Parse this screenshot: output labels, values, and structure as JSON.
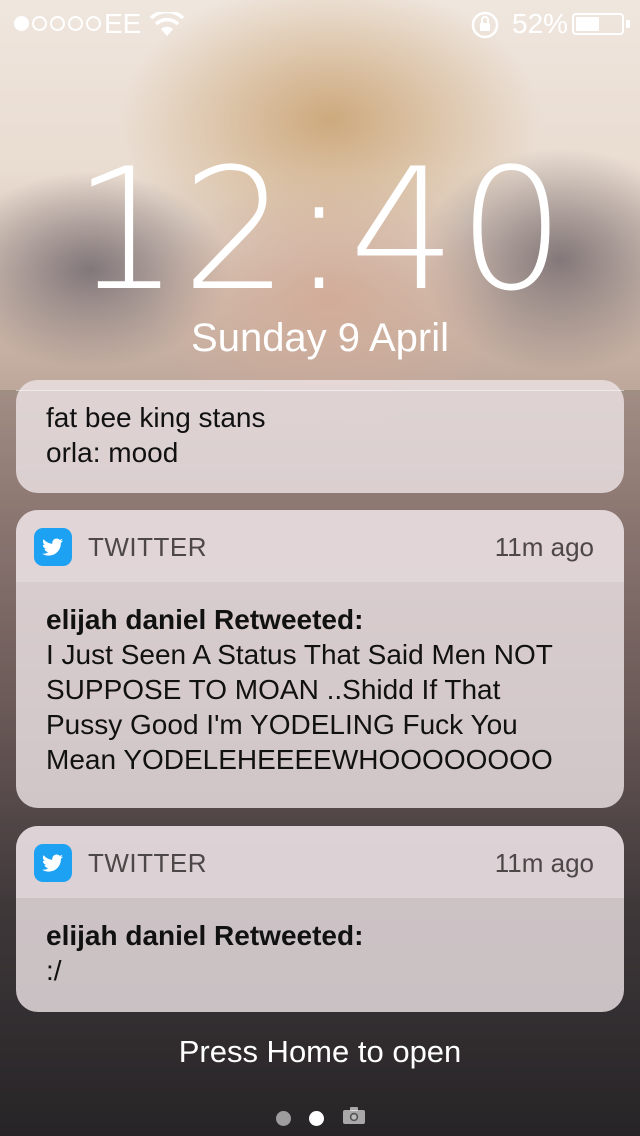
{
  "status_bar": {
    "signal_full": 1,
    "signal_total": 5,
    "carrier": "EE",
    "battery_percent_label": "52%",
    "battery_level": 0.52
  },
  "lock_screen": {
    "time": "12:40",
    "date": "Sunday 9 April",
    "press_home": "Press Home to open"
  },
  "notifications": [
    {
      "partial": true,
      "lines": [
        "fat bee king stans",
        "orla: mood"
      ]
    },
    {
      "app": "TWITTER",
      "time_ago": "11m ago",
      "title": "elijah daniel Retweeted:",
      "body_lines": [
        "I Just Seen A Status That Said Men NOT",
        "SUPPOSE TO MOAN  ..Shidd If That",
        "Pussy Good I'm YODELING Fuck You",
        "Mean YODELEHEEEEWHOOOOOOOO"
      ]
    },
    {
      "app": "TWITTER",
      "time_ago": "11m ago",
      "title": "elijah daniel Retweeted:",
      "body_lines": [
        ":/"
      ]
    }
  ],
  "page_indicator": {
    "pages": 2,
    "active": 1,
    "camera_icon": "camera-icon"
  },
  "colors": {
    "twitter_blue": "#1da1f2",
    "text_white": "#ffffff"
  }
}
